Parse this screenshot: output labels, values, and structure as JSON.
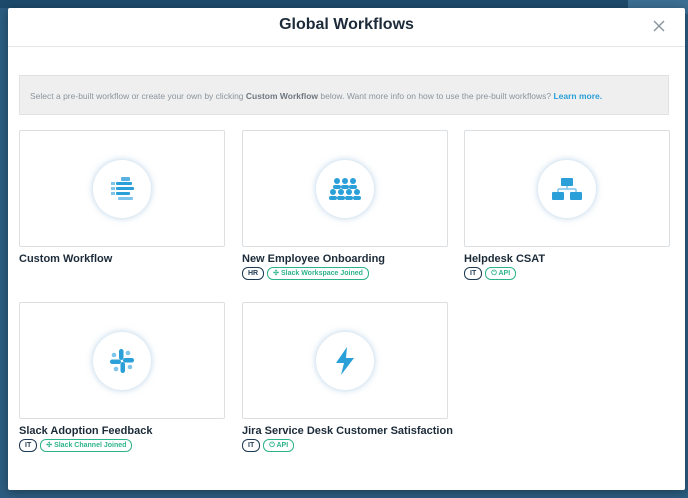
{
  "modal": {
    "title": "Global Workflows",
    "info": {
      "part1": "Select a pre-built workflow or create your own by clicking ",
      "bold": "Custom Workflow",
      "part2": " below. Want more info on how to use the pre-built workflows? ",
      "link": "Learn more."
    }
  },
  "cards": [
    {
      "name": "Custom Workflow",
      "icon": "custom-workflow-icon",
      "tags": []
    },
    {
      "name": "New Employee Onboarding",
      "icon": "people-group-icon",
      "tags": [
        {
          "label": "HR"
        },
        {
          "label": "Slack Workspace Joined",
          "icon": "slack-icon"
        }
      ]
    },
    {
      "name": "Helpdesk CSAT",
      "icon": "network-icon",
      "tags": [
        {
          "label": "IT"
        },
        {
          "label": "API",
          "icon": "power-icon"
        }
      ]
    },
    {
      "name": "Slack Adoption Feedback",
      "icon": "slack-icon",
      "tags": [
        {
          "label": "IT"
        },
        {
          "label": "Slack Channel Joined",
          "icon": "slack-icon"
        }
      ]
    },
    {
      "name": "Jira Service Desk Customer Satisfaction",
      "icon": "lightning-icon",
      "tags": [
        {
          "label": "IT"
        },
        {
          "label": "API",
          "icon": "power-icon"
        }
      ]
    }
  ],
  "colors": {
    "accent": "#2a9fd8",
    "tag_green": "#2db38a",
    "navy": "#1e3a52"
  }
}
